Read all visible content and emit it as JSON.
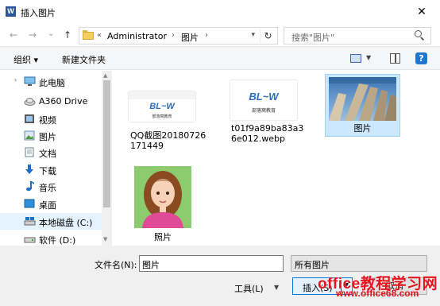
{
  "window": {
    "title": "插入图片",
    "app_icon": "W",
    "close_label": "✕"
  },
  "nav": {
    "back": "←",
    "forward": "→",
    "recent": "⌄",
    "up": "↑",
    "address_prefix": "«",
    "address": [
      "Administrator",
      "图片"
    ],
    "search_placeholder": "搜索\"图片\""
  },
  "toolbar": {
    "organize": "组织 ▾",
    "new_folder": "新建文件夹",
    "help": "?"
  },
  "sidebar": {
    "items": [
      {
        "label": "此电脑",
        "icon": "computer-icon"
      },
      {
        "label": "A360 Drive",
        "icon": "cloud-drive-icon"
      },
      {
        "label": "视频",
        "icon": "video-folder-icon"
      },
      {
        "label": "图片",
        "icon": "picture-folder-icon"
      },
      {
        "label": "文档",
        "icon": "document-folder-icon"
      },
      {
        "label": "下载",
        "icon": "download-icon"
      },
      {
        "label": "音乐",
        "icon": "music-icon"
      },
      {
        "label": "桌面",
        "icon": "desktop-icon"
      },
      {
        "label": "本地磁盘 (C:)",
        "icon": "drive-c-icon"
      },
      {
        "label": "软件 (D:)",
        "icon": "drive-d-icon"
      }
    ]
  },
  "files": [
    {
      "name": "QQ截图20180726171449",
      "kind": "logo-image",
      "logo_text": "部落窝教育"
    },
    {
      "name": "t01f9a89ba83a36e012.webp",
      "kind": "logo-image",
      "logo_text": "部落窝教育"
    },
    {
      "name": "图片",
      "kind": "photo-columns"
    },
    {
      "name": "照片",
      "kind": "photo-avatar"
    }
  ],
  "footer": {
    "filename_label": "文件名(N):",
    "filename_value": "图片",
    "filetype_value": "所有图片",
    "tools_label": "工具(L)",
    "insert_label": "插入(S)",
    "cancel_label": "取消"
  },
  "watermark": {
    "line1": "office教程学习网",
    "line2": "www.office68.com"
  },
  "colors": {
    "selection": "#cce8ff",
    "accent": "#0078d7",
    "watermark": "#e5141f",
    "logo_blue": "#2b6fb8"
  }
}
